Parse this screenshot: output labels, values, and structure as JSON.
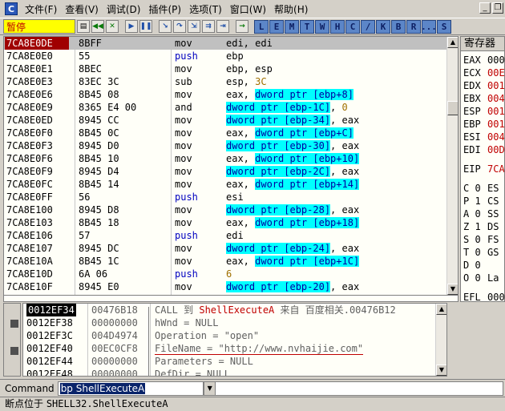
{
  "app": {
    "icon_letter": "C",
    "menus": [
      "文件(F)",
      "查看(V)",
      "调试(D)",
      "插件(P)",
      "选项(T)",
      "窗口(W)",
      "帮助(H)"
    ]
  },
  "toolbar": {
    "status": "暂停",
    "letter_buttons": [
      "L",
      "E",
      "M",
      "T",
      "W",
      "H",
      "C",
      "/",
      "K",
      "B",
      "R",
      "...",
      "S"
    ]
  },
  "disasm": {
    "rows": [
      {
        "addr": "7CA8E0DE",
        "hex": "8BFF",
        "mn": "mov",
        "op": [
          {
            "t": "edi, edi"
          }
        ]
      },
      {
        "addr": "7CA8E0E0",
        "hex": "55",
        "mn": "push",
        "mnc": "blue",
        "op": [
          {
            "t": "ebp"
          }
        ]
      },
      {
        "addr": "7CA8E0E1",
        "hex": "8BEC",
        "mn": "mov",
        "op": [
          {
            "t": "ebp, esp"
          }
        ]
      },
      {
        "addr": "7CA8E0E3",
        "hex": "83EC 3C",
        "mn": "sub",
        "op": [
          {
            "t": "esp, "
          },
          {
            "t": "3C",
            "s": "num"
          }
        ]
      },
      {
        "addr": "7CA8E0E6",
        "hex": "8B45 08",
        "mn": "mov",
        "op": [
          {
            "t": "eax, "
          },
          {
            "t": "dword ptr [ebp+8]",
            "s": "hl"
          }
        ]
      },
      {
        "addr": "7CA8E0E9",
        "hex": "8365 E4 00",
        "mn": "and",
        "op": [
          {
            "t": "dword ptr [ebp-1C]",
            "s": "hl"
          },
          {
            "t": ", "
          },
          {
            "t": "0",
            "s": "num"
          }
        ]
      },
      {
        "addr": "7CA8E0ED",
        "hex": "8945 CC",
        "mn": "mov",
        "op": [
          {
            "t": "dword ptr [ebp-34]",
            "s": "hl"
          },
          {
            "t": ", eax"
          }
        ]
      },
      {
        "addr": "7CA8E0F0",
        "hex": "8B45 0C",
        "mn": "mov",
        "op": [
          {
            "t": "eax, "
          },
          {
            "t": "dword ptr [ebp+C]",
            "s": "hl"
          }
        ]
      },
      {
        "addr": "7CA8E0F3",
        "hex": "8945 D0",
        "mn": "mov",
        "op": [
          {
            "t": "dword ptr [ebp-30]",
            "s": "hl"
          },
          {
            "t": ", eax"
          }
        ]
      },
      {
        "addr": "7CA8E0F6",
        "hex": "8B45 10",
        "mn": "mov",
        "op": [
          {
            "t": "eax, "
          },
          {
            "t": "dword ptr [ebp+10]",
            "s": "hl"
          }
        ]
      },
      {
        "addr": "7CA8E0F9",
        "hex": "8945 D4",
        "mn": "mov",
        "op": [
          {
            "t": "dword ptr [ebp-2C]",
            "s": "hl"
          },
          {
            "t": ", eax"
          }
        ]
      },
      {
        "addr": "7CA8E0FC",
        "hex": "8B45 14",
        "mn": "mov",
        "op": [
          {
            "t": "eax, "
          },
          {
            "t": "dword ptr [ebp+14]",
            "s": "hl"
          }
        ]
      },
      {
        "addr": "7CA8E0FF",
        "hex": "56",
        "mn": "push",
        "mnc": "blue",
        "op": [
          {
            "t": "esi"
          }
        ]
      },
      {
        "addr": "7CA8E100",
        "hex": "8945 D8",
        "mn": "mov",
        "op": [
          {
            "t": "dword ptr [ebp-28]",
            "s": "hl"
          },
          {
            "t": ", eax"
          }
        ]
      },
      {
        "addr": "7CA8E103",
        "hex": "8B45 18",
        "mn": "mov",
        "op": [
          {
            "t": "eax, "
          },
          {
            "t": "dword ptr [ebp+18]",
            "s": "hl"
          }
        ]
      },
      {
        "addr": "7CA8E106",
        "hex": "57",
        "mn": "push",
        "mnc": "blue",
        "op": [
          {
            "t": "edi"
          }
        ]
      },
      {
        "addr": "7CA8E107",
        "hex": "8945 DC",
        "mn": "mov",
        "op": [
          {
            "t": "dword ptr [ebp-24]",
            "s": "hl"
          },
          {
            "t": ", eax"
          }
        ]
      },
      {
        "addr": "7CA8E10A",
        "hex": "8B45 1C",
        "mn": "mov",
        "op": [
          {
            "t": "eax, "
          },
          {
            "t": "dword ptr [ebp+1C]",
            "s": "hl"
          }
        ]
      },
      {
        "addr": "7CA8E10D",
        "hex": "6A 06",
        "mn": "push",
        "mnc": "blue",
        "op": [
          {
            "t": "6",
            "s": "num"
          }
        ]
      },
      {
        "addr": "7CA8E10F",
        "hex": "8945 E0",
        "mn": "mov",
        "op": [
          {
            "t": "dword ptr [ebp-20]",
            "s": "hl"
          },
          {
            "t": ", eax"
          }
        ]
      }
    ]
  },
  "registers": {
    "title": "寄存器",
    "main": [
      {
        "n": "EAX",
        "v": "000"
      },
      {
        "n": "ECX",
        "v": "00E",
        "red": true
      },
      {
        "n": "EDX",
        "v": "001",
        "red": true
      },
      {
        "n": "EBX",
        "v": "004",
        "red": true
      },
      {
        "n": "ESP",
        "v": "001",
        "red": true
      },
      {
        "n": "EBP",
        "v": "001",
        "red": true
      },
      {
        "n": "ESI",
        "v": "004",
        "red": true
      },
      {
        "n": "EDI",
        "v": "00D",
        "red": true
      }
    ],
    "eip": {
      "n": "EIP",
      "v": "7CA",
      "red": true
    },
    "flags": [
      {
        "n": "C 0",
        "v": "ES"
      },
      {
        "n": "P 1",
        "v": "CS"
      },
      {
        "n": "A 0",
        "v": "SS"
      },
      {
        "n": "Z 1",
        "v": "DS"
      },
      {
        "n": "S 0",
        "v": "FS"
      },
      {
        "n": "T 0",
        "v": "GS"
      },
      {
        "n": "D 0",
        "v": ""
      },
      {
        "n": "O 0",
        "v": "La"
      }
    ],
    "efl": {
      "n": "EFL",
      "v": "000"
    }
  },
  "stack": {
    "rows": [
      {
        "addr": "0012EF34",
        "val": "00476B18",
        "cm": [
          {
            "t": "CALL 到 "
          },
          {
            "t": "ShellExecuteA",
            "s": "api"
          },
          {
            "t": " 来自 百度相关.00476B12"
          }
        ]
      },
      {
        "addr": "0012EF38",
        "val": "00000000",
        "cm": [
          {
            "t": "hWnd = NULL"
          }
        ]
      },
      {
        "addr": "0012EF3C",
        "val": "004D4974",
        "cm": [
          {
            "t": "Operation = \"open\""
          }
        ]
      },
      {
        "addr": "0012EF40",
        "val": "00EC0CF8",
        "cm": [
          {
            "t": "FileName = \"http://www.nvhaijie.com\"",
            "s": "ul"
          }
        ]
      },
      {
        "addr": "0012EF44",
        "val": "00000000",
        "cm": [
          {
            "t": "Parameters = NULL"
          }
        ]
      },
      {
        "addr": "0012EF48",
        "val": "00000000",
        "cm": [
          {
            "t": "DefDir = NULL"
          }
        ]
      }
    ]
  },
  "command": {
    "label": "Command",
    "value": "bp ShellExecuteA"
  },
  "status": {
    "text": "断点位于 ",
    "where": "SHELL32.ShellExecuteA"
  }
}
